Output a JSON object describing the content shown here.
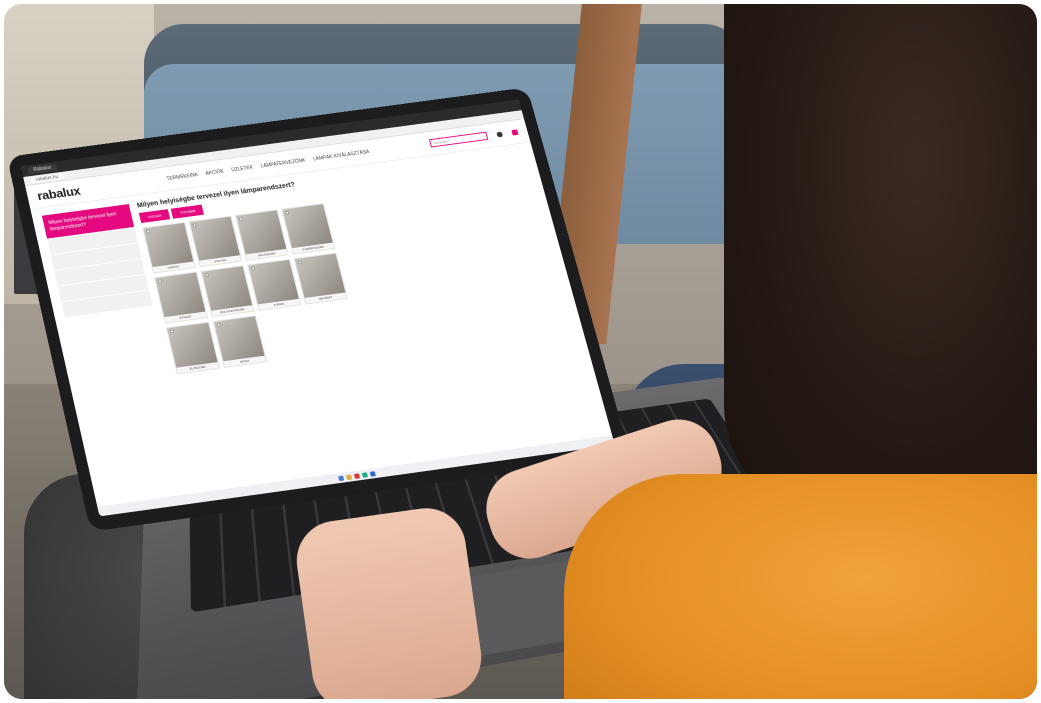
{
  "browser": {
    "tab_title": "Rabalux",
    "url": "rabalux.hu"
  },
  "site": {
    "logo": "rabalux",
    "nav": [
      "Termékeink",
      "Akciók",
      "Üzletek",
      "Lámpatervezőnk",
      "Lámpák kiválasztása"
    ],
    "search_placeholder": "Keresés"
  },
  "sidebar": {
    "active_item": "Milyen helyiségbe tervezel ilyen lámparendszert?"
  },
  "main": {
    "question": "Milyen helyiségbe tervezel ilyen lámparendszert?",
    "back_button": "Vissza",
    "next_button": "Tovább",
    "rooms": [
      "Nappali",
      "Konyha",
      "Hálószoba",
      "Gyerekszoba",
      "Étkező",
      "Dolgozószoba",
      "Fürdő",
      "Bejárat",
      "Előszoba",
      "Iroda",
      "Előtér"
    ]
  },
  "colors": {
    "accent": "#e5097f"
  }
}
